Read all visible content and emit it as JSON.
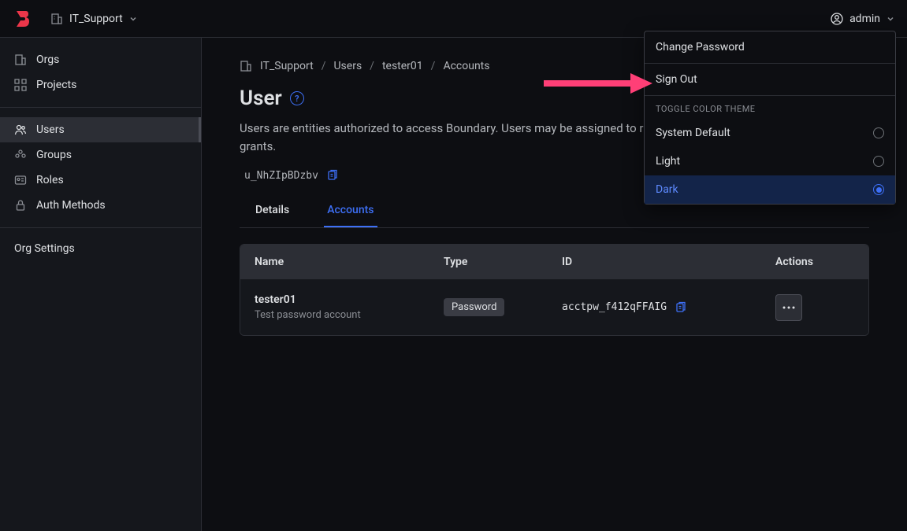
{
  "header": {
    "org_name": "IT_Support",
    "user_name": "admin"
  },
  "sidebar": {
    "primary": [
      {
        "icon": "orgs",
        "label": "Orgs"
      },
      {
        "icon": "projects",
        "label": "Projects"
      }
    ],
    "secondary": [
      {
        "icon": "users",
        "label": "Users",
        "active": true
      },
      {
        "icon": "groups",
        "label": "Groups"
      },
      {
        "icon": "roles",
        "label": "Roles"
      },
      {
        "icon": "auth",
        "label": "Auth Methods"
      }
    ],
    "settings_label": "Org Settings"
  },
  "breadcrumb": {
    "items": [
      "IT_Support",
      "Users",
      "tester01",
      "Accounts"
    ]
  },
  "page": {
    "title": "User",
    "description": "Users are entities authorized to access Boundary. Users may be assigned to roles as principals, thus receiving role grants.",
    "user_id": "u_NhZIpBDzbv"
  },
  "tabs": [
    {
      "label": "Details",
      "active": false
    },
    {
      "label": "Accounts",
      "active": true
    }
  ],
  "table": {
    "headers": {
      "name": "Name",
      "type": "Type",
      "id": "ID",
      "actions": "Actions"
    },
    "rows": [
      {
        "name": "tester01",
        "desc": "Test password account",
        "type": "Password",
        "id": "acctpw_f412qFFAIG"
      }
    ]
  },
  "dropdown": {
    "items": [
      "Change Password",
      "Sign Out"
    ],
    "theme_label": "TOGGLE COLOR THEME",
    "themes": [
      {
        "label": "System Default",
        "selected": false
      },
      {
        "label": "Light",
        "selected": false
      },
      {
        "label": "Dark",
        "selected": true
      }
    ]
  }
}
